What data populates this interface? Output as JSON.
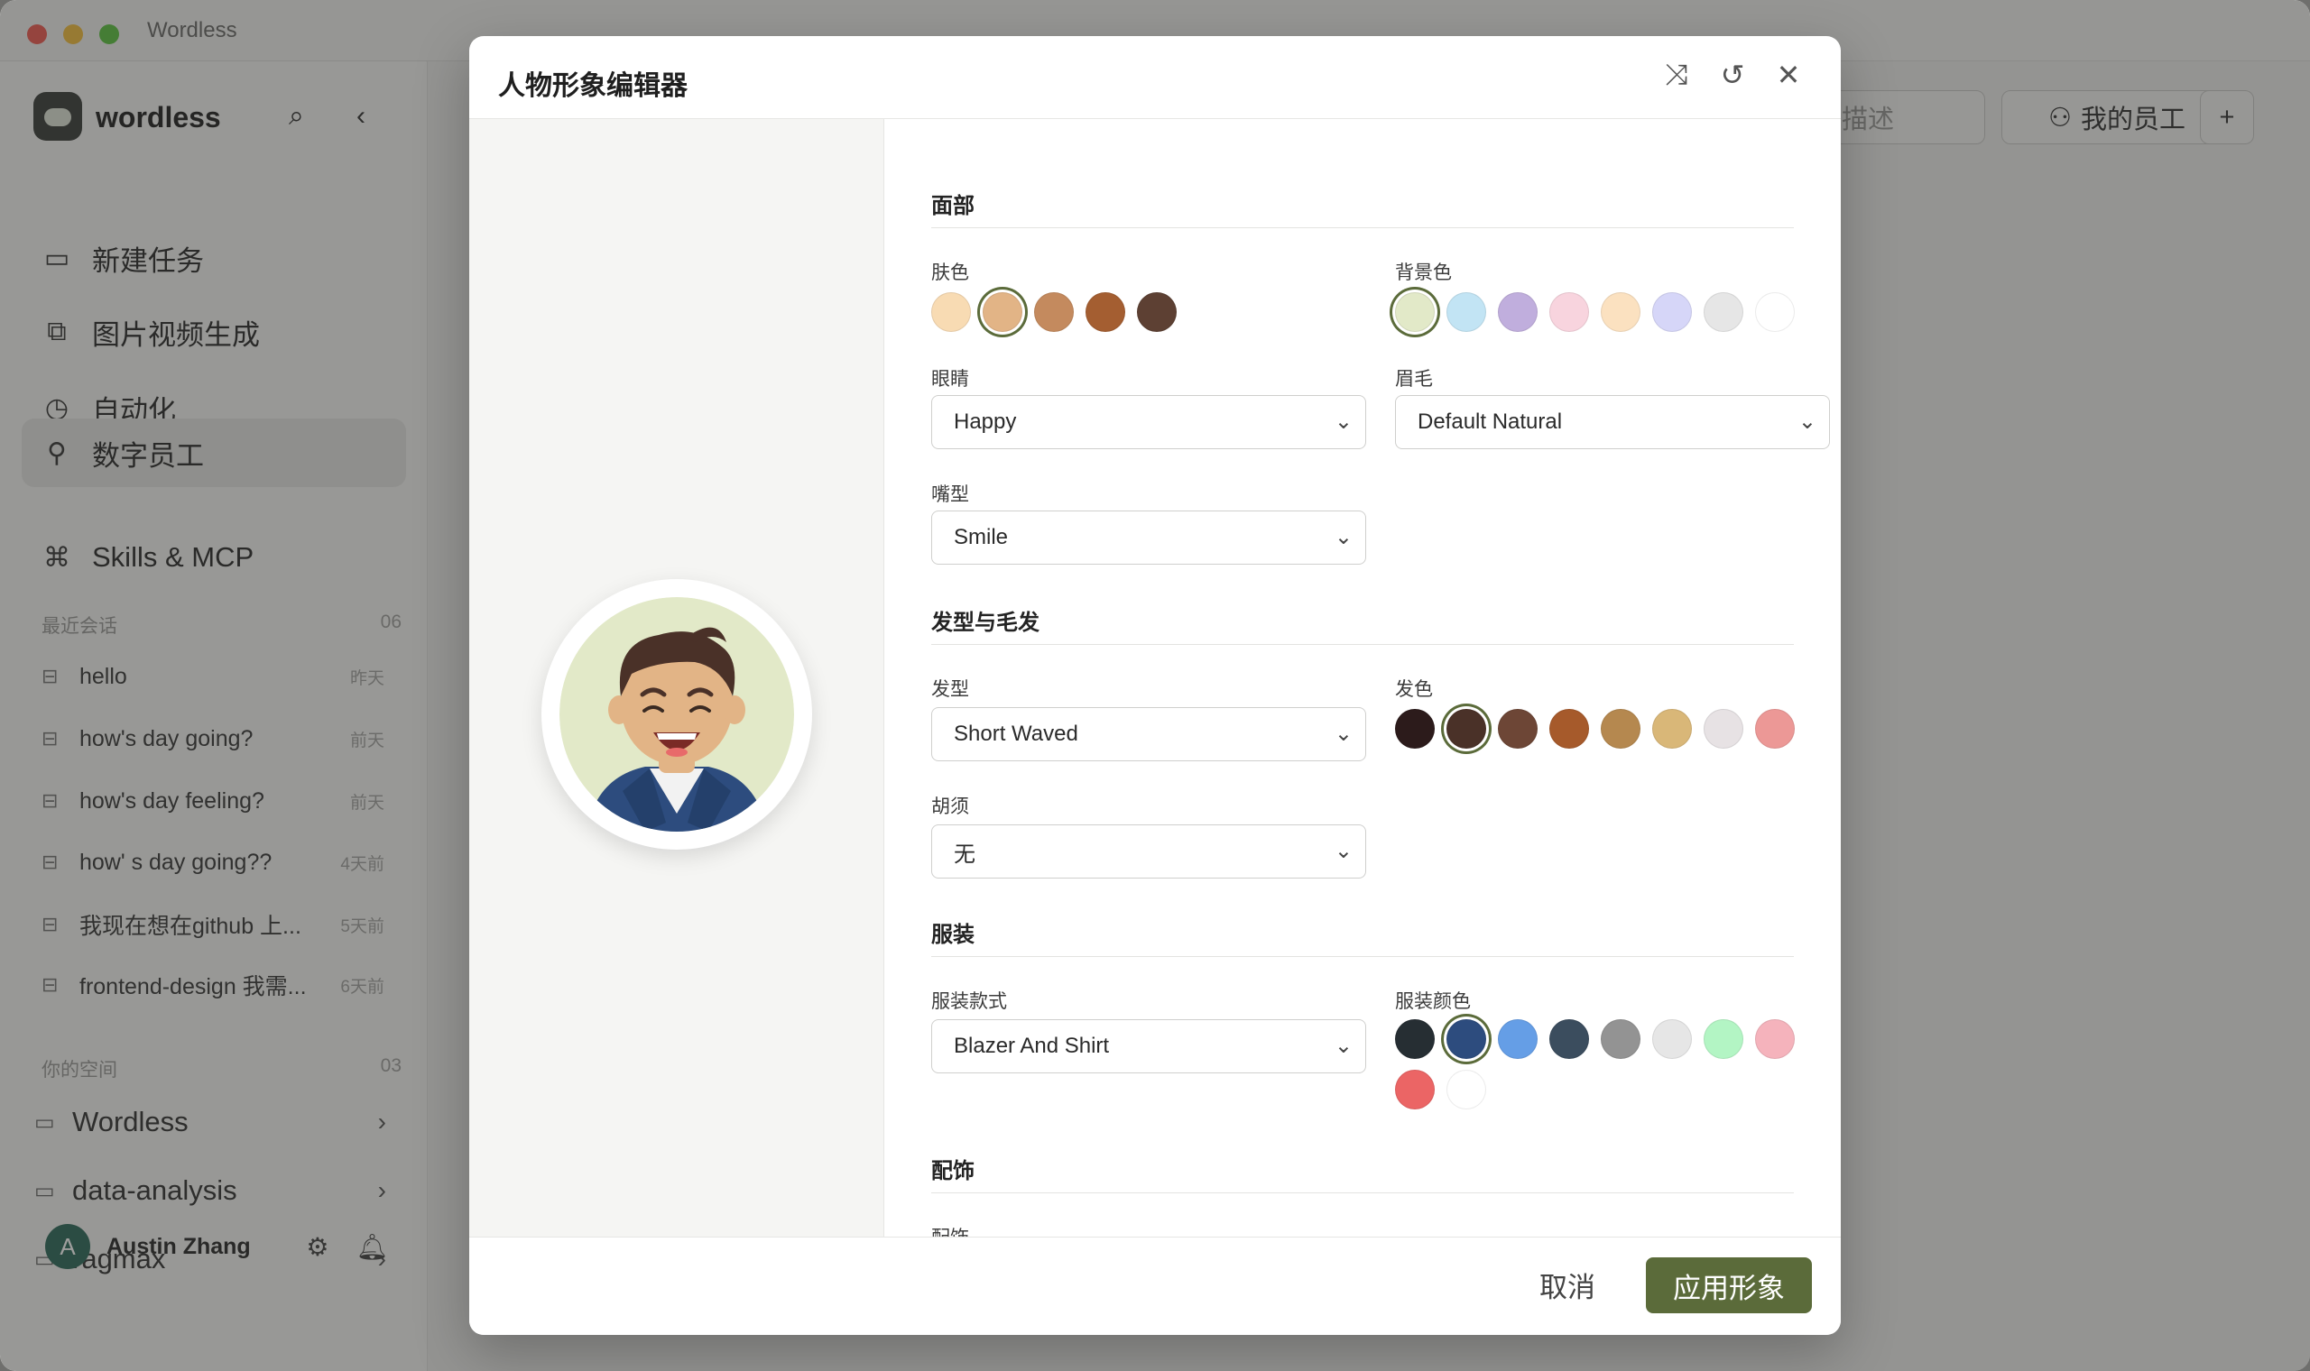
{
  "window": {
    "title": "Wordless"
  },
  "sidebar": {
    "brand": "wordless",
    "nav": [
      {
        "label": "新建任务",
        "icon": "folder-icon"
      },
      {
        "label": "图片视频生成",
        "icon": "image-icon"
      },
      {
        "label": "自动化",
        "icon": "calendar-clock-icon"
      },
      {
        "label": "数字员工",
        "icon": "user-search-icon"
      },
      {
        "label": "Skills & MCP",
        "icon": "command-icon"
      }
    ],
    "recent": {
      "title": "最近会话",
      "count": "06",
      "items": [
        {
          "title": "hello",
          "date": "昨天"
        },
        {
          "title": "how's day going?",
          "date": "前天"
        },
        {
          "title": "how's day feeling?",
          "date": "前天"
        },
        {
          "title": "how' s day going??",
          "date": "4天前"
        },
        {
          "title": "我现在想在github 上...",
          "date": "5天前"
        },
        {
          "title": "frontend-design 我需...",
          "date": "6天前"
        }
      ]
    },
    "spaces": {
      "title": "你的空间",
      "count": "03",
      "items": [
        "Wordless",
        "data-analysis",
        "ragmax"
      ]
    },
    "user": {
      "initial": "A",
      "name": "Austin Zhang"
    }
  },
  "topbar": {
    "search_placeholder": "描述",
    "my_staff": "我的员工",
    "add": "+"
  },
  "modal": {
    "title": "人物形象编辑器",
    "sections": {
      "face": "面部",
      "hair": "发型与毛发",
      "clothing": "服装",
      "accessories": "配饰"
    },
    "labels": {
      "skin": "肤色",
      "background": "背景色",
      "eyes": "眼睛",
      "eyebrows": "眉毛",
      "mouth": "嘴型",
      "hair_style": "发型",
      "hair_color": "发色",
      "beard": "胡须",
      "outfit": "服装款式",
      "outfit_color": "服装颜色",
      "accessory": "配饰"
    },
    "values": {
      "eyes": "Happy",
      "eyebrows": "Default Natural",
      "mouth": "Smile",
      "hair_style": "Short Waved",
      "beard": "无",
      "outfit": "Blazer And Shirt"
    },
    "palettes": {
      "skin": {
        "colors": [
          "#f8dbb3",
          "#e2b486",
          "#c48a5e",
          "#a45e31",
          "#5d4033"
        ],
        "selected": 1
      },
      "background": {
        "colors": [
          "#e2e9c8",
          "#c2e4f4",
          "#c0aedd",
          "#f8d4de",
          "#fbe1c0",
          "#d6d6f8",
          "#e6e6e6",
          "#ffffff"
        ],
        "selected": 0
      },
      "hair_color": {
        "colors": [
          "#2c1b1b",
          "#4a3128",
          "#6d4636",
          "#a65a2b",
          "#b5884f",
          "#d9b778",
          "#e7e2e4",
          "#ec9896"
        ],
        "selected": 1
      },
      "outfit_color": {
        "colors": [
          "#262e33",
          "#2d4c7e",
          "#659ee6",
          "#3b4d5e",
          "#939393",
          "#e6e6e6",
          "#b3f5c4",
          "#f5b3bc",
          "#eb6565",
          "#ffffff"
        ],
        "selected": 1
      }
    },
    "footer": {
      "cancel": "取消",
      "apply": "应用形象"
    }
  }
}
